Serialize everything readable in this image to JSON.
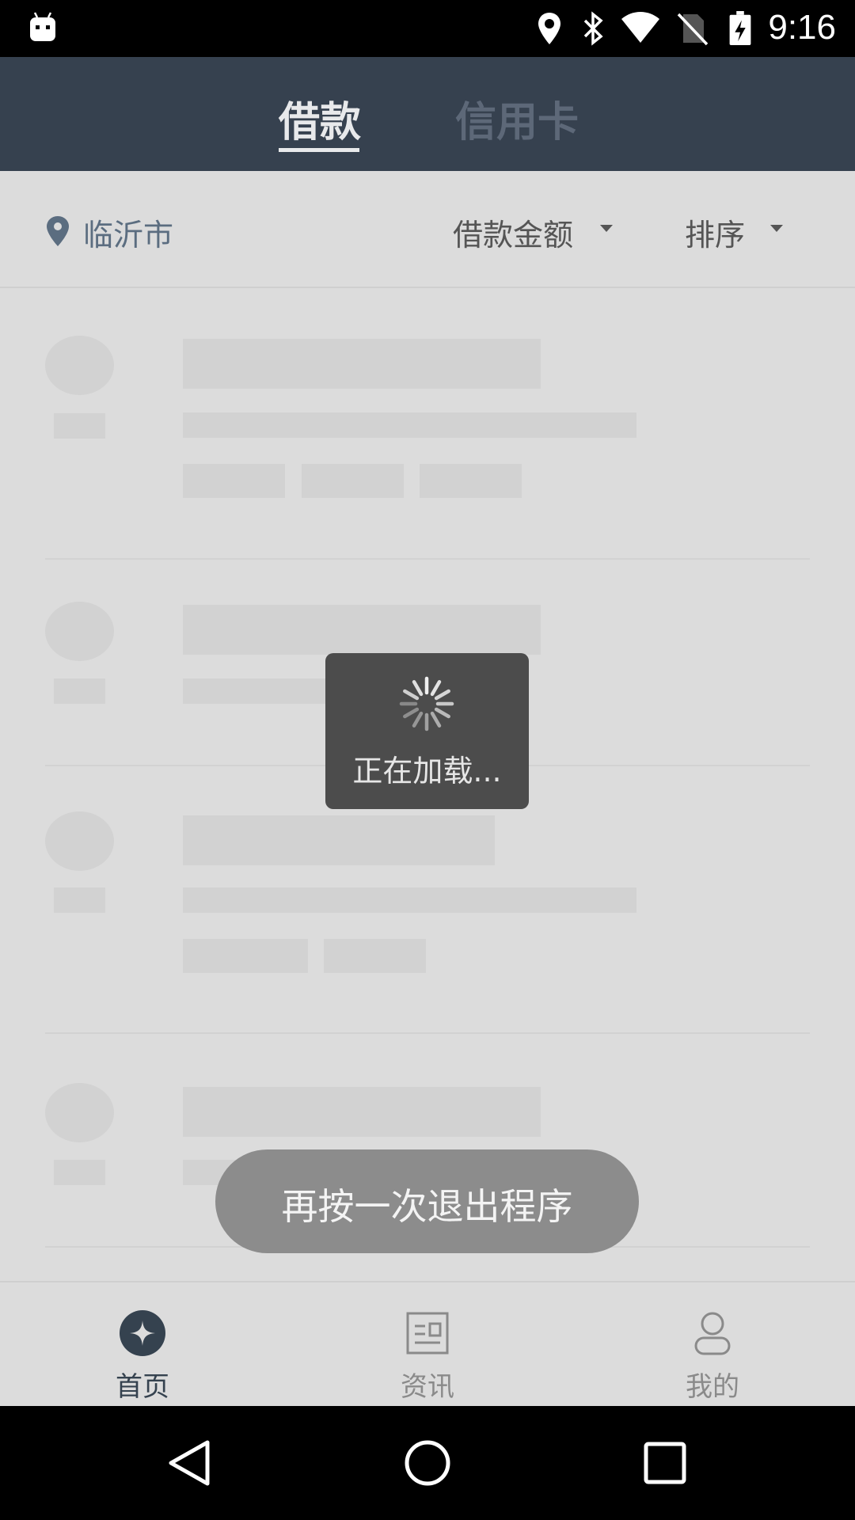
{
  "status_bar": {
    "time": "9:16",
    "icons": [
      "android-icon",
      "location-icon",
      "bluetooth-icon",
      "wifi-icon",
      "no-sim-icon",
      "battery-charging-icon"
    ]
  },
  "header": {
    "tabs": [
      {
        "label": "借款",
        "active": true
      },
      {
        "label": "信用卡",
        "active": false
      }
    ]
  },
  "filter_bar": {
    "location": "临沂市",
    "amount_filter": "借款金额",
    "sort_filter": "排序"
  },
  "loading": {
    "text": "正在加载..."
  },
  "toast": {
    "text": "再按一次退出程序"
  },
  "bottom_nav": {
    "items": [
      {
        "label": "首页",
        "icon": "home-icon",
        "active": true
      },
      {
        "label": "资讯",
        "icon": "news-icon",
        "active": false
      },
      {
        "label": "我的",
        "icon": "profile-icon",
        "active": false
      }
    ]
  },
  "system_nav": {
    "buttons": [
      "back-icon",
      "home-button-icon",
      "recents-icon"
    ]
  },
  "colors": {
    "header_bg": "#36414f",
    "accent": "#35424f",
    "location_text": "#5b6d80",
    "skeleton": "#d2d2d2"
  }
}
